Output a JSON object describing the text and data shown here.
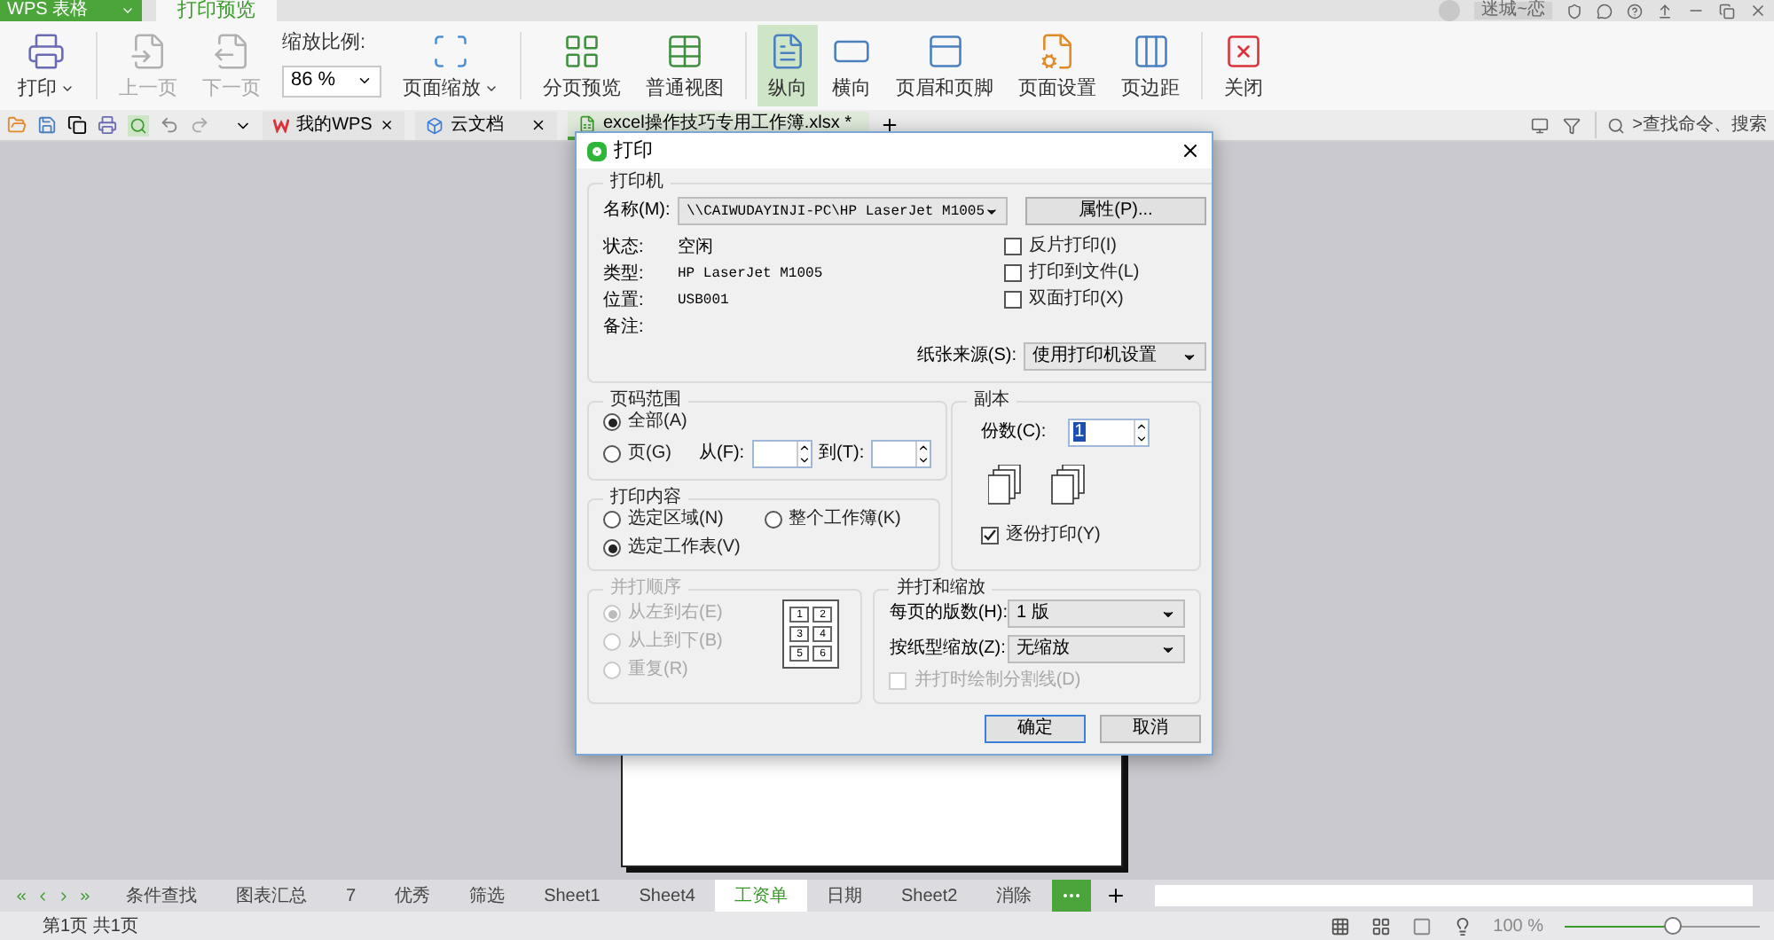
{
  "app_tab": {
    "label": "WPS 表格"
  },
  "ribbon_tab": {
    "label": "打印预览"
  },
  "user": {
    "name": "迷城~恋"
  },
  "ribbon": [
    [
      {
        "kind": "button",
        "label": "打印",
        "dropdown": true,
        "disabled": false,
        "selected": false
      }
    ],
    [
      {
        "kind": "button",
        "label": "上一页",
        "dropdown": false,
        "disabled": true,
        "selected": false
      },
      {
        "kind": "button",
        "label": "下一页",
        "dropdown": false,
        "disabled": true,
        "selected": false
      },
      {
        "kind": "zoom",
        "label": "缩放比例:",
        "value": "86 %"
      },
      {
        "kind": "button",
        "label": "页面缩放",
        "dropdown": true,
        "disabled": false,
        "selected": false
      }
    ],
    [
      {
        "kind": "button",
        "label": "分页预览",
        "dropdown": false,
        "disabled": false,
        "selected": false
      },
      {
        "kind": "button",
        "label": "普通视图",
        "dropdown": false,
        "disabled": false,
        "selected": false
      }
    ],
    [
      {
        "kind": "button",
        "label": "纵向",
        "dropdown": false,
        "disabled": false,
        "selected": true
      },
      {
        "kind": "button",
        "label": "横向",
        "dropdown": false,
        "disabled": false,
        "selected": false
      },
      {
        "kind": "button",
        "label": "页眉和页脚",
        "dropdown": false,
        "disabled": false,
        "selected": false
      },
      {
        "kind": "button",
        "label": "页面设置",
        "dropdown": false,
        "disabled": false,
        "selected": false
      },
      {
        "kind": "button",
        "label": "页边距",
        "dropdown": false,
        "disabled": false,
        "selected": false
      }
    ],
    [
      {
        "kind": "button",
        "label": "关闭",
        "dropdown": false,
        "disabled": false,
        "selected": false
      }
    ]
  ],
  "doc_tabs": [
    {
      "label": "我的WPS",
      "selected": false
    },
    {
      "label": "云文档",
      "selected": false
    },
    {
      "label": "excel操作技巧专用工作簿.xlsx *",
      "selected": true
    }
  ],
  "search": {
    "placeholder": ">查找命令、搜索"
  },
  "dialog": {
    "title": "打印",
    "printer": {
      "legend": "打印机",
      "name_label": "名称(M):",
      "name_value": "\\\\CAIWUDAYINJI-PC\\HP LaserJet M1005",
      "properties_button": "属性(P)...",
      "info": [
        {
          "label": "状态:",
          "value": "空闲"
        },
        {
          "label": "类型:",
          "value": "HP LaserJet M1005"
        },
        {
          "label": "位置:",
          "value": "USB001"
        },
        {
          "label": "备注:"
        }
      ],
      "options": [
        {
          "label": "反片打印(I)",
          "checked": false
        },
        {
          "label": "打印到文件(L)",
          "checked": false
        },
        {
          "label": "双面打印(X)",
          "checked": false
        }
      ],
      "paper_source_label": "纸张来源(S):",
      "paper_source_value": "使用打印机设置"
    },
    "page_range": {
      "legend": "页码范围",
      "options": [
        {
          "label": "全部(A)",
          "selected": true
        },
        {
          "label": "页(G)",
          "selected": false
        }
      ],
      "from_label": "从(F):",
      "to_label": "到(T):"
    },
    "content": {
      "legend": "打印内容",
      "options": [
        {
          "label": "选定区域(N)",
          "selected": false
        },
        {
          "label": "整个工作簿(K)",
          "selected": false
        },
        {
          "label": "选定工作表(V)",
          "selected": true
        }
      ]
    },
    "copies": {
      "legend": "副本",
      "label": "份数(C):",
      "value": "1",
      "collate": {
        "label": "逐份打印(Y)",
        "checked": true
      }
    },
    "order": {
      "legend": "并打顺序",
      "disabled": true,
      "options": [
        {
          "label": "从左到右(E)",
          "selected": true
        },
        {
          "label": "从上到下(B)",
          "selected": false
        },
        {
          "label": "重复(R)",
          "selected": false
        }
      ],
      "diagram_labels": [
        "1",
        "2",
        "3",
        "4",
        "5",
        "6"
      ]
    },
    "scaling": {
      "legend": "并打和缩放",
      "per_page_label": "每页的版数(H):",
      "per_page_value": "1 版",
      "scale_label": "按纸型缩放(Z):",
      "scale_value": "无缩放",
      "divider": {
        "label": "并打时绘制分割线(D)",
        "checked": false,
        "disabled": true
      }
    },
    "buttons": [
      "确定",
      "取消"
    ]
  },
  "sheet_tabs": [
    {
      "label": "条件查找",
      "selected": false
    },
    {
      "label": "图表汇总",
      "selected": false
    },
    {
      "label": "7",
      "selected": false
    },
    {
      "label": "优秀",
      "selected": false
    },
    {
      "label": "筛选",
      "selected": false
    },
    {
      "label": "Sheet1",
      "selected": false
    },
    {
      "label": "Sheet4",
      "selected": false
    },
    {
      "label": "工资单",
      "selected": true
    },
    {
      "label": "日期",
      "selected": false
    },
    {
      "label": "Sheet2",
      "selected": false
    },
    {
      "label": "消除",
      "selected": false
    }
  ],
  "status_bar": {
    "pages": "第1页 共1页",
    "zoom": "100 %",
    "zoom_slider": {
      "level": 0.55
    }
  }
}
